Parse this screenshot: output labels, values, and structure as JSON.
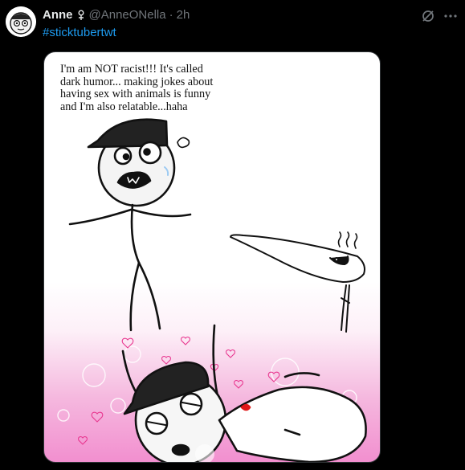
{
  "post": {
    "author_name": "Anne",
    "author_handle": "@AnneONella",
    "separator": "·",
    "time": "2h",
    "hashtag": "#sticktubertwt",
    "media": {
      "caption": "I'm am NOT racist!!! It's called\n dark humor... making jokes about\nhaving sex with animals is funny\nand I'm also relatable...haha"
    }
  },
  "icons": {
    "badge": "person-symbol-icon",
    "mute": "mute-icon",
    "more": "more-icon"
  },
  "colors": {
    "background": "#000000",
    "text": "#e7e9ea",
    "muted": "#71767b",
    "link": "#1d9bf0",
    "image_pink": "#f28fcf"
  }
}
